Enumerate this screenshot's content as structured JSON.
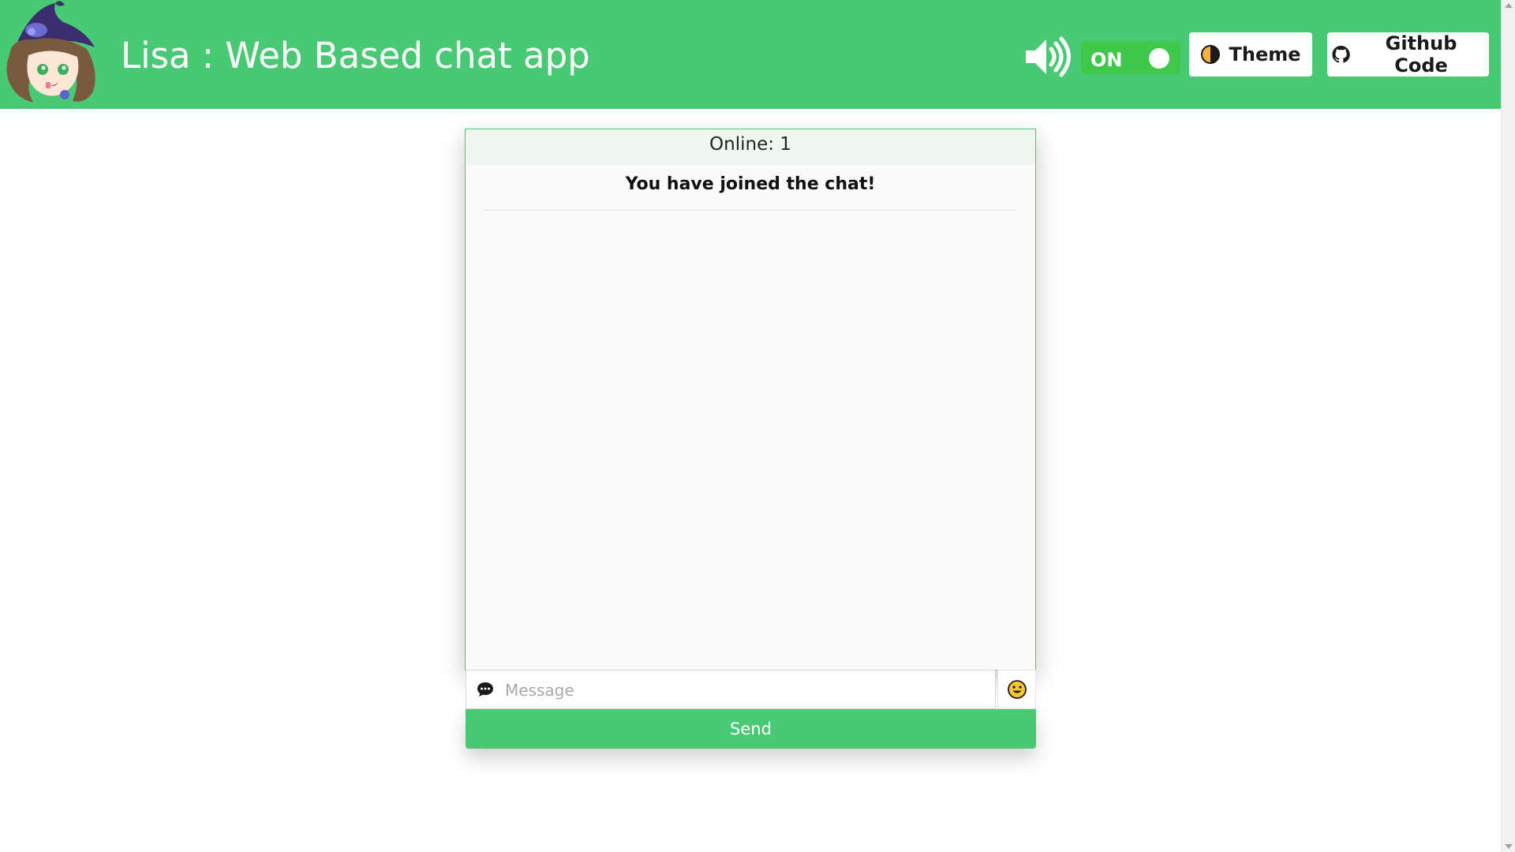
{
  "header": {
    "title": "Lisa : Web Based chat app",
    "logo_icon": "witch-avatar-logo",
    "sound_icon": "speaker-volume-icon",
    "sound_toggle": {
      "label": "ON",
      "state": "on"
    },
    "theme_button": {
      "label": "Theme",
      "icon": "half-moon-icon"
    },
    "github_button": {
      "label": "Github Code",
      "icon": "github-icon"
    }
  },
  "chat": {
    "online_label": "Online: 1",
    "messages": [
      {
        "type": "system",
        "text": "You have joined the chat!"
      }
    ]
  },
  "composer": {
    "placeholder": "Message",
    "value": "",
    "input_icon": "chat-bubble-icon",
    "emoji_icon": "smiley-emoji-icon",
    "send_label": "Send"
  },
  "colors": {
    "accent": "#49c973",
    "toggle_on": "#3ec94a",
    "header_text": "#ffffff"
  }
}
